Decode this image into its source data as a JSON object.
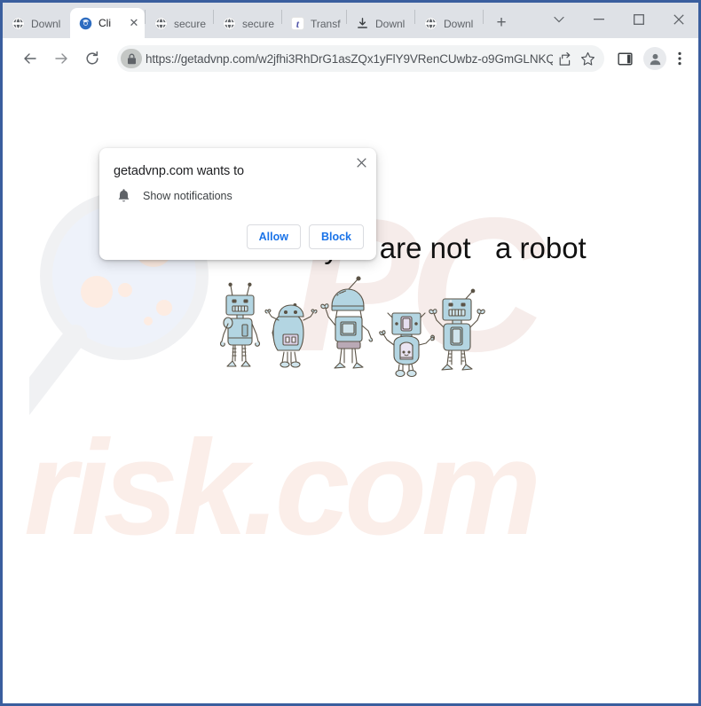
{
  "window": {
    "border_color": "#3a5e9e",
    "controls": {
      "tab_search_label": "⌄",
      "minimize_label": "—",
      "maximize_label": "▫",
      "close_label": "✕"
    }
  },
  "tabstrip": {
    "new_tab_label": "+",
    "tabs": [
      {
        "title": "Downl",
        "icon": "globe-icon",
        "active": false
      },
      {
        "title": "Cli",
        "icon": "chrome-icon",
        "active": true,
        "close_label": "✕"
      },
      {
        "title": "secure",
        "icon": "globe-icon",
        "active": false
      },
      {
        "title": "secure",
        "icon": "globe-icon",
        "active": false
      },
      {
        "title": "Transf",
        "icon": "letter-t-icon",
        "active": false
      },
      {
        "title": "Downl",
        "icon": "download-icon",
        "active": false
      },
      {
        "title": "Downl",
        "icon": "globe-icon",
        "active": false
      }
    ]
  },
  "toolbar": {
    "back_icon": "arrow-left-icon",
    "forward_icon": "arrow-right-icon",
    "reload_icon": "reload-icon",
    "lock_icon": "lock-icon",
    "url": "https://getadvnp.com/w2jfhi3RhDrG1asZQx1yFlY9VRenCUwbz-o9GmGLNKQ...",
    "share_icon": "share-icon",
    "bookmark_icon": "star-icon",
    "side_panel_icon": "side-panel-icon",
    "profile_icon": "profile-avatar-icon",
    "menu_icon": "three-dot-menu-icon"
  },
  "dialog": {
    "title": "getadvnp.com wants to",
    "permission_icon": "bell-icon",
    "permission_label": "Show notifications",
    "allow_label": "Allow",
    "block_label": "Block",
    "close_label": "✕",
    "accent_color": "#1a73e8"
  },
  "page": {
    "headline": "Click \"Allow\"   if you are not   a robot",
    "robots_count": 5,
    "watermark_pc": "PC",
    "watermark_risk": "risk.com",
    "watermark_color": "#f7ece8",
    "robot_body_color": "#a8d0dd",
    "robot_outline_color": "#5b5346",
    "background_color": "#ffffff"
  }
}
